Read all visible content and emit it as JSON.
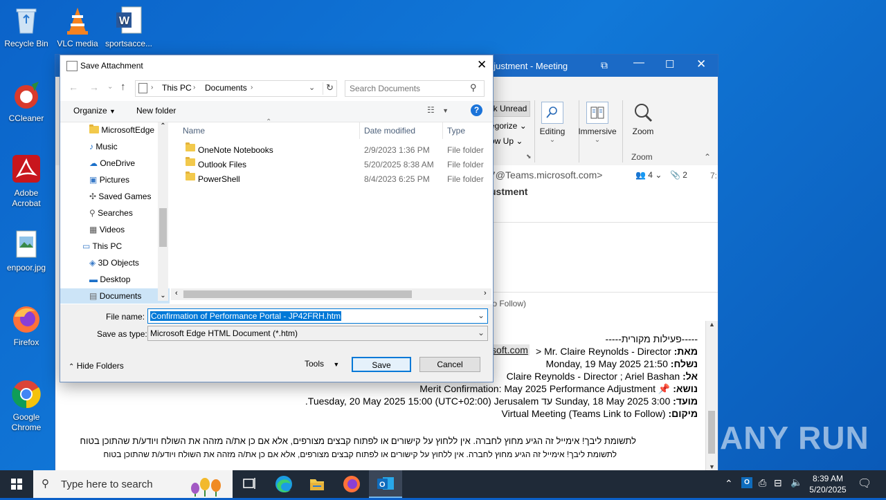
{
  "desktop": {
    "icons": [
      {
        "label": "Recycle Bin",
        "icon": "recycle-bin-icon"
      },
      {
        "label": "VLC media",
        "icon": "vlc-icon"
      },
      {
        "label": "sportsacce...",
        "icon": "word-document-icon"
      },
      {
        "label": "CCleaner",
        "icon": "ccleaner-icon"
      },
      {
        "label": "Adobe Acrobat",
        "icon": "acrobat-icon"
      },
      {
        "label": "enpoor.jpg",
        "icon": "image-file-icon"
      },
      {
        "label": "Firefox",
        "icon": "firefox-icon"
      },
      {
        "label": "Google Chrome",
        "icon": "chrome-icon"
      }
    ],
    "watermark": "ANY RUN"
  },
  "outlook": {
    "title_partial": "djustment  -  Meeting",
    "ribbon": {
      "mark_unread": "k Unread",
      "categorize": "egorize",
      "follow_up": "ow Up",
      "editing": "Editing",
      "immersive": "Immersive",
      "zoom": "Zoom",
      "zoom_group": "Zoom"
    },
    "header": {
      "from_email": "7@Teams.microsoft.com>",
      "attendees_count": "4",
      "attachments_count": "2",
      "time_partial": "7:",
      "subject_partial": "ustment",
      "location_partial": "to Follow)"
    },
    "body_lines": [
      "-----פעילות מקורית-----",
      "מאת: Mr. Claire Reynolds - Director <soft.com",
      "נשלח: Monday, 19 May 2025 21:50",
      "אל: Claire Reynolds - Director ; Ariel Bashan",
      "נושא: Merit Confirmation: May 2025 Performance Adjustment",
      "מועד: Sunday, 18 May 2025 3:00 עד Tuesday, 20 May 2025 15:00 (UTC+02:00) Jerusalem.",
      "מיקום: Virtual Meeting (Teams Link to Follow)",
      "לתשומת ליבך! אימייל זה הגיע מחוץ לחברה. אין ללחוץ על קישורים או לפתוח קבצים מצורפים, אלא אם כן את/ה מזהה את השולח ויודע/ת שהתוכן בטוח",
      "לתשומת ליבך! אימייל זה הגיע מחוץ לחברה. אין ללחוץ על קישורים או לפתוח קבצים מצורפים, אלא אם כן את/ה מזהה את השולח ויודע/ת שהתוכן בטוח"
    ],
    "body_link": "soft.com"
  },
  "dialog": {
    "title": "Save Attachment",
    "breadcrumb": [
      "This PC",
      "Documents"
    ],
    "search_placeholder": "Search Documents",
    "toolbar": {
      "organize": "Organize",
      "new_folder": "New folder"
    },
    "nav_items": [
      {
        "label": "MicrosoftEdge",
        "icon": "folder-icon"
      },
      {
        "label": "Music",
        "icon": "music-icon"
      },
      {
        "label": "OneDrive",
        "icon": "onedrive-icon"
      },
      {
        "label": "Pictures",
        "icon": "pictures-icon"
      },
      {
        "label": "Saved Games",
        "icon": "saved-games-icon"
      },
      {
        "label": "Searches",
        "icon": "searches-icon"
      },
      {
        "label": "Videos",
        "icon": "videos-icon"
      },
      {
        "label": "This PC",
        "icon": "this-pc-icon"
      },
      {
        "label": "3D Objects",
        "icon": "3d-objects-icon"
      },
      {
        "label": "Desktop",
        "icon": "desktop-icon"
      },
      {
        "label": "Documents",
        "icon": "documents-icon"
      }
    ],
    "columns": {
      "name": "Name",
      "date": "Date modified",
      "type": "Type"
    },
    "files": [
      {
        "name": "OneNote Notebooks",
        "date": "2/9/2023 1:36 PM",
        "type": "File folder"
      },
      {
        "name": "Outlook Files",
        "date": "5/20/2025 8:38 AM",
        "type": "File folder"
      },
      {
        "name": "PowerShell",
        "date": "8/4/2023 6:25 PM",
        "type": "File folder"
      }
    ],
    "file_name_label": "File name:",
    "file_name_value": "Confirmation of Performance Portal - JP42FRH.htm",
    "save_type_label": "Save as type:",
    "save_type_value": "Microsoft Edge HTML Document (*.htm)",
    "hide_folders": "Hide Folders",
    "tools": "Tools",
    "save": "Save",
    "cancel": "Cancel"
  },
  "taskbar": {
    "search_placeholder": "Type here to search",
    "time": "8:39 AM",
    "date": "5/20/2025"
  }
}
